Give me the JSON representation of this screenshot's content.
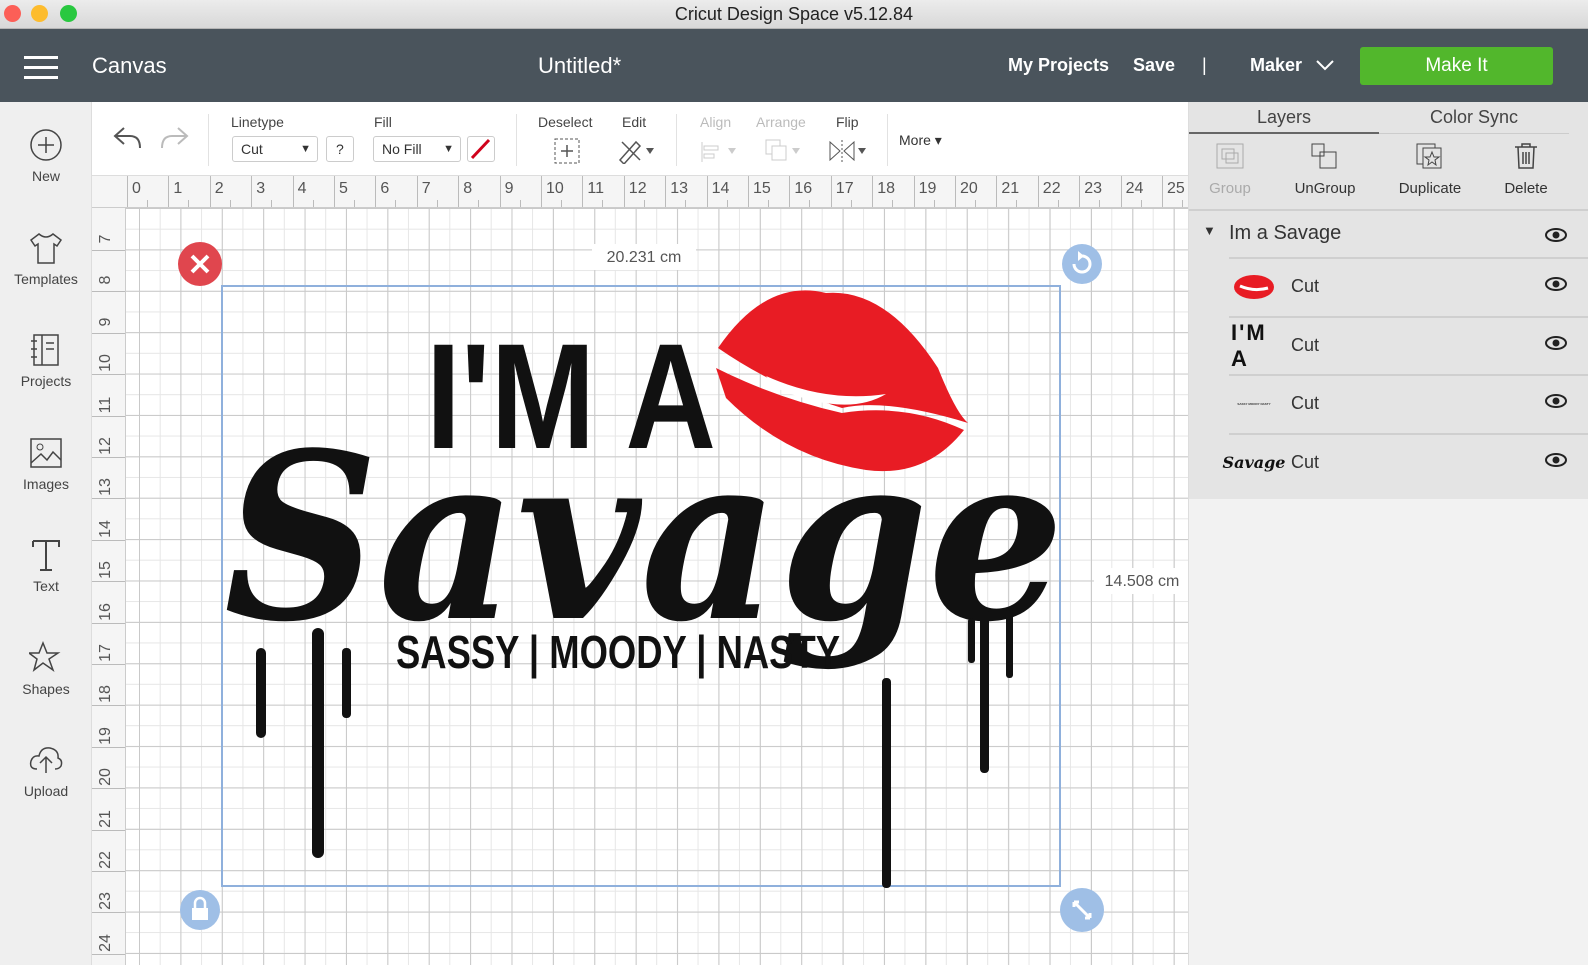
{
  "window": {
    "title": "Cricut Design Space  v5.12.84"
  },
  "header": {
    "section": "Canvas",
    "doc_title": "Untitled*",
    "my_projects": "My Projects",
    "save": "Save",
    "divider": "|",
    "machine": "Maker",
    "make_it": "Make It",
    "accent": "#52b72c"
  },
  "toolbar": {
    "linetype_label": "Linetype",
    "linetype_value": "Cut",
    "help": "?",
    "fill_label": "Fill",
    "fill_value": "No Fill",
    "deselect": "Deselect",
    "edit": "Edit",
    "align": "Align",
    "arrange": "Arrange",
    "flip": "Flip",
    "more": "More"
  },
  "sidebar": {
    "items": [
      {
        "label": "New",
        "icon": "plus-circle-icon"
      },
      {
        "label": "Templates",
        "icon": "shirt-icon"
      },
      {
        "label": "Projects",
        "icon": "projects-icon"
      },
      {
        "label": "Images",
        "icon": "image-icon"
      },
      {
        "label": "Text",
        "icon": "text-icon"
      },
      {
        "label": "Shapes",
        "icon": "shapes-icon"
      },
      {
        "label": "Upload",
        "icon": "upload-icon"
      }
    ]
  },
  "ruler": {
    "h": [
      "0",
      "1",
      "2",
      "3",
      "4",
      "5",
      "6",
      "7",
      "8",
      "9",
      "10",
      "11",
      "12",
      "13",
      "14",
      "15",
      "16",
      "17",
      "18",
      "19",
      "20",
      "21",
      "22",
      "23",
      "24",
      "25"
    ],
    "v": [
      "7",
      "8",
      "9",
      "10",
      "11",
      "12",
      "13",
      "14",
      "15",
      "16",
      "17",
      "18",
      "19",
      "20",
      "21",
      "22",
      "23",
      "24"
    ]
  },
  "canvas": {
    "width_label": "20.231 cm",
    "height_label": "14.508 cm",
    "art": {
      "line1": "I'M A",
      "line2": "Savage",
      "line3": "SASSY | MOODY | NASTY"
    }
  },
  "panel": {
    "tabs": [
      "Layers",
      "Color Sync"
    ],
    "actions": [
      "Group",
      "UnGroup",
      "Duplicate",
      "Delete"
    ],
    "group_name": "Im a Savage",
    "layers": [
      {
        "thumb": "lips",
        "label": "Cut"
      },
      {
        "thumb": "I'M A",
        "label": "Cut"
      },
      {
        "thumb": "SASSY MOODY NASTY",
        "label": "Cut"
      },
      {
        "thumb": "Savage",
        "label": "Cut"
      }
    ]
  }
}
